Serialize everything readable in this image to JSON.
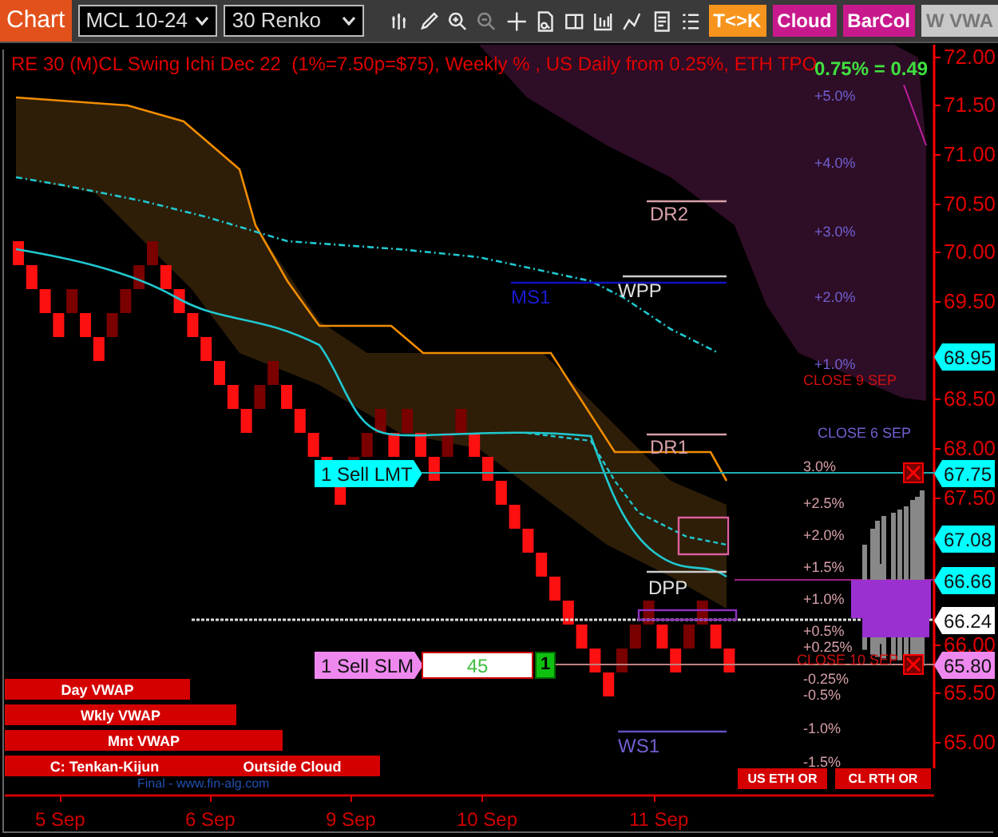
{
  "toolbar": {
    "title": "Chart",
    "symbol": {
      "value": "MCL 10-24"
    },
    "interval": {
      "value": "30 Renko"
    },
    "toggles": [
      {
        "label": "T<>K",
        "color": "#f7941d"
      },
      {
        "label": "Cloud",
        "color": "#c8198c"
      },
      {
        "label": "BarCol",
        "color": "#c8198c"
      },
      {
        "label": "W VWA",
        "color": "#c8c8c8"
      }
    ]
  },
  "chart": {
    "title": "RE 30 (M)CL Swing Ichi Dec 22  (1%=7.50p=$75), Weekly % , US Daily from 0.25%, ETH TPO",
    "ratio": "0.75% = 0.49",
    "price_axis": [
      "72.00",
      "71.50",
      "71.00",
      "70.50",
      "70.00",
      "69.50",
      "68.50",
      "68.00",
      "67.50",
      "66.00",
      "65.50",
      "65.00"
    ],
    "price_tags": [
      {
        "text": "68.95",
        "kind": "level"
      },
      {
        "text": "67.75",
        "kind": "level"
      },
      {
        "text": "67.08",
        "kind": "level"
      },
      {
        "text": "66.66",
        "kind": "level"
      },
      {
        "text": "66.24",
        "kind": "last"
      },
      {
        "text": "65.80",
        "kind": "stop"
      }
    ],
    "weekly_percents": [
      "+5.0%",
      "+4.0%",
      "+3.0%",
      "+2.0%",
      "+1.0%"
    ],
    "daily_percents": [
      "3.0%",
      "+2.5%",
      "+2.0%",
      "+1.5%",
      "+1.0%",
      "+0.5%",
      "+0.25%",
      "-0.25%",
      "-0.5%",
      "-1.0%",
      "-1.5%"
    ],
    "close_labels": [
      {
        "text": "CLOSE 9 SEP",
        "color": "#d01010"
      },
      {
        "text": "CLOSE 6 SEP",
        "color": "#7060d0"
      },
      {
        "text": "CLOSE 10 SEP",
        "color": "#d01010"
      }
    ],
    "pivots": [
      {
        "label": "DR2",
        "color": "#d8a0a8"
      },
      {
        "label": "WPP",
        "color": "#e0e0e0"
      },
      {
        "label": "MS1",
        "color": "#1a1ad0"
      },
      {
        "label": "DR1",
        "color": "#d8a0a8"
      },
      {
        "label": "DPP",
        "color": "#e0e0e0"
      },
      {
        "label": "WS1",
        "color": "#7060d0"
      }
    ],
    "orders": [
      {
        "label": "1 Sell LMT",
        "kind": "limit"
      },
      {
        "label": "1 Sell SLM",
        "kind": "stop",
        "quantity": "45",
        "count": "1"
      }
    ],
    "study_buttons": [
      "Day VWAP",
      "Wkly VWAP",
      "Mnt VWAP",
      "C: Tenkan-Kijun",
      "Outside Cloud"
    ],
    "credit": "Final - www.fin-alg.com",
    "range_buttons": [
      "US ETH OR",
      "CL RTH OR"
    ],
    "time_axis": [
      "5 Sep",
      "6 Sep",
      "9 Sep",
      "10 Sep",
      "11 Sep"
    ]
  }
}
